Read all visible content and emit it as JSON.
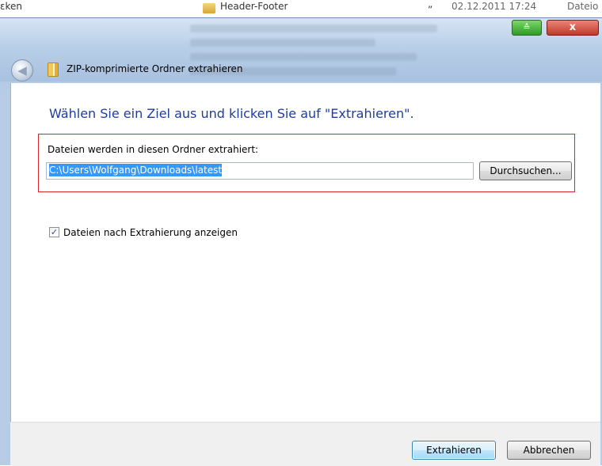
{
  "background_explorer": {
    "left_fragment": "ɛken",
    "folder_name": "Header-Footer",
    "date_modified": "02.12.2011 17:24",
    "type_fragment": "Dateio",
    "quote_mark": "„"
  },
  "window": {
    "title": "ZIP-komprimierte Ordner extrahieren",
    "minimize_glyph": "≙",
    "close_glyph": "x",
    "back_glyph": "◀"
  },
  "content": {
    "heading": "Wählen Sie ein Ziel aus und klicken Sie auf \"Extrahieren\".",
    "folder_label": "Dateien werden in diesen Ordner extrahiert:",
    "path_value": "C:\\Users\\Wolfgang\\Downloads\\latest",
    "browse_label": "Durchsuchen...",
    "checkbox_label": "Dateien nach Extrahierung anzeigen",
    "checkbox_checked": true,
    "checkbox_glyph": "✓"
  },
  "footer": {
    "extract_label": "Extrahieren",
    "cancel_label": "Abbrechen"
  },
  "colors": {
    "heading": "#1e3e9a",
    "highlight_border": "#d8262c",
    "selection": "#3399ff"
  },
  "icons": [
    "back-arrow-icon",
    "zip-folder-icon",
    "checkmark-icon"
  ]
}
